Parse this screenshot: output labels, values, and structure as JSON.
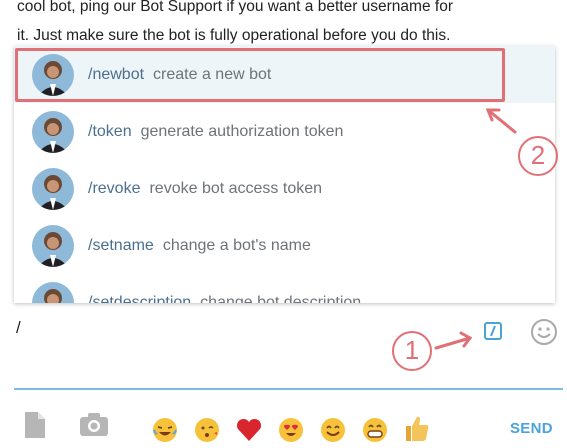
{
  "chat": {
    "line1": "cool bot, ping our Bot Support if you want a better username for",
    "line2": "it. Just make sure the bot is fully operational before you do this."
  },
  "commands": [
    {
      "name": "/newbot",
      "desc": "create a new bot",
      "selected": true
    },
    {
      "name": "/token",
      "desc": "generate authorization token",
      "selected": false
    },
    {
      "name": "/revoke",
      "desc": "revoke bot access token",
      "selected": false
    },
    {
      "name": "/setname",
      "desc": "change a bot's name",
      "selected": false
    },
    {
      "name": "/setdescription",
      "desc": "change bot description",
      "selected": false
    }
  ],
  "input": {
    "value": "/"
  },
  "callouts": {
    "one": "1",
    "two": "2"
  },
  "toolbar": {
    "icons": [
      "file-icon",
      "camera-icon",
      "emoji-joy-icon",
      "emoji-kiss-icon",
      "heart-icon",
      "emoji-heart-eyes-icon",
      "emoji-smile-icon",
      "emoji-grin-icon",
      "thumbs-up-icon"
    ],
    "send_label": "SEND"
  },
  "colors": {
    "accent": "#4aa3df",
    "annotation": "#e07076",
    "command": "#4b6f8e"
  }
}
